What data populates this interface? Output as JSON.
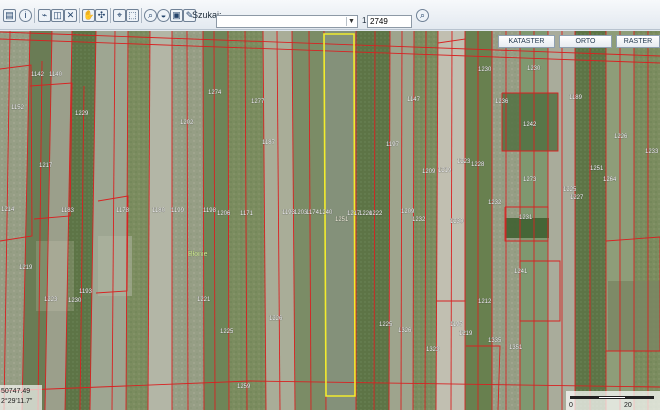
{
  "toolbar": {
    "icons": [
      "print-icon",
      "info-icon",
      "measure-length-icon",
      "measure-area-icon",
      "clear-icon",
      "hand-icon",
      "pan-icon",
      "coordinates-icon",
      "select-icon",
      "zoom-icon",
      "water-icon",
      "save-icon",
      "edit-icon"
    ],
    "search_label": "Szukaj:",
    "search_value": "",
    "scale_prefix": "1:",
    "scale_value": "2749",
    "search_button_icon": "magnifier-icon"
  },
  "layers": [
    "KATASTER",
    "ORTO",
    "RASTER"
  ],
  "map": {
    "place_label": "Błonie",
    "parcel_labels": [
      "1142",
      "1140",
      "1152",
      "1229",
      "1217",
      "1214",
      "1183",
      "1219",
      "1223",
      "1230",
      "1193",
      "1178",
      "1180",
      "1199",
      "1202",
      "1274",
      "1277",
      "1187",
      "1198",
      "1206",
      "1171",
      "1193",
      "1203",
      "1174",
      "1240",
      "1212",
      "1217",
      "1220",
      "1222",
      "1221",
      "1225",
      "1226",
      "1259",
      "1147",
      "1197",
      "1209",
      "1219",
      "1223",
      "1228",
      "1230",
      "1236",
      "1230",
      "1242",
      "1189",
      "1226",
      "1233",
      "1251",
      "1264",
      "1225",
      "1227",
      "1273",
      "1232",
      "1231",
      "1230",
      "1209",
      "1232",
      "1241",
      "1212",
      "1197",
      "1219",
      "1225",
      "1326",
      "1323",
      "1335",
      "1351"
    ],
    "selected_label": "1251"
  },
  "status": {
    "coord_line1": "50747.49",
    "coord_line2": "2°29'11.7\"",
    "scale_start": "0",
    "scale_end": "20"
  },
  "colors": {
    "parcel_boundary": "#d82222",
    "selected_parcel": "#f2ec2d",
    "toolbar_bg": "#eef3f8"
  }
}
